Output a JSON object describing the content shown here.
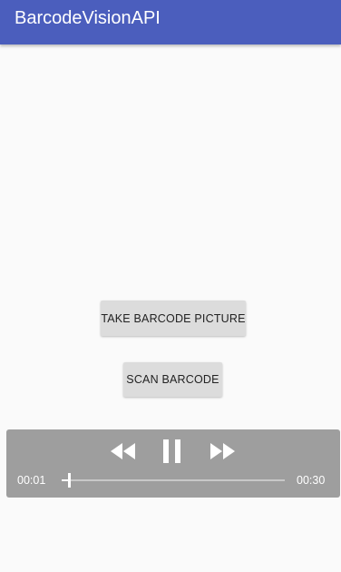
{
  "app_bar": {
    "title": "BarcodeVisionAPI",
    "color": "#4b5ebd"
  },
  "buttons": {
    "take_picture_label": "TAKE BARCODE PICTURE",
    "scan_label": "SCAN BARCODE"
  },
  "media_controller": {
    "rewind_icon": "rewind-icon",
    "pause_icon": "pause-icon",
    "fast_forward_icon": "fast-forward-icon",
    "current_time": "00:01",
    "total_time": "00:30",
    "progress_fraction": 0.033,
    "background_color": "#9e9e9e"
  }
}
